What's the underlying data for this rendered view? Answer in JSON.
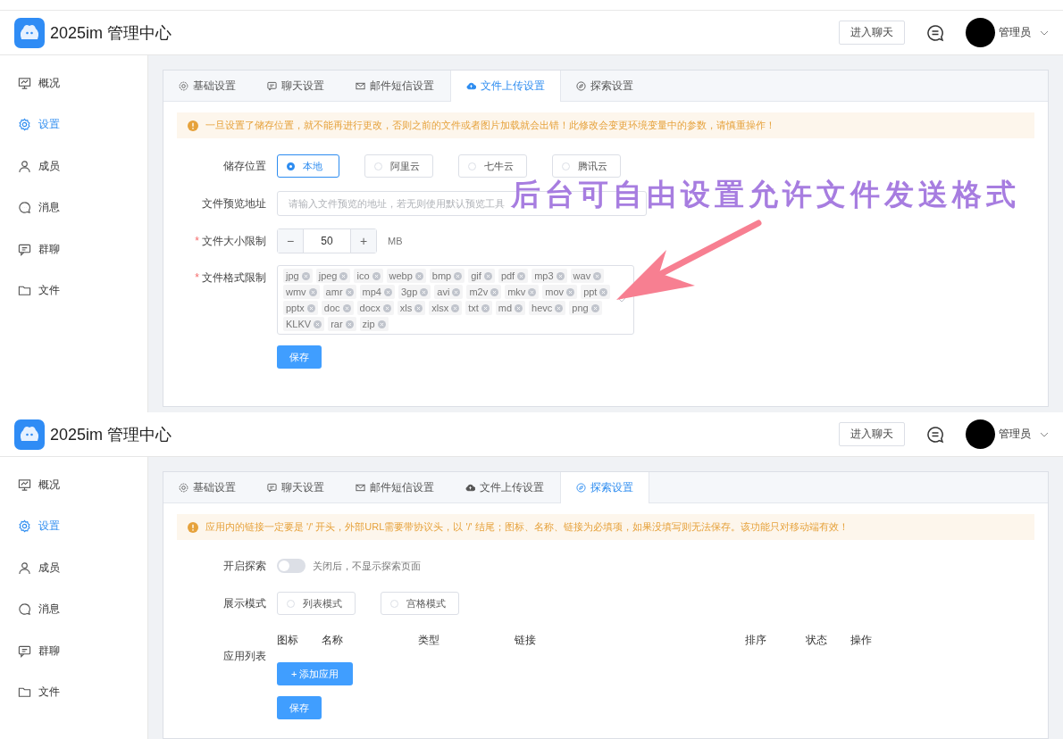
{
  "screens": [
    {
      "header": {
        "title": "2025im 管理中心",
        "chat_button": "进入聊天",
        "user": "管理员"
      },
      "sidebar": {
        "items": [
          {
            "label": "概况",
            "selected": false
          },
          {
            "label": "设置",
            "selected": true
          },
          {
            "label": "成员",
            "selected": false
          },
          {
            "label": "消息",
            "selected": false
          },
          {
            "label": "群聊",
            "selected": false
          },
          {
            "label": "文件",
            "selected": false
          }
        ]
      },
      "tabs": [
        {
          "label": "基础设置",
          "selected": false
        },
        {
          "label": "聊天设置",
          "selected": false
        },
        {
          "label": "邮件短信设置",
          "selected": false
        },
        {
          "label": "文件上传设置",
          "selected": true
        },
        {
          "label": "探索设置",
          "selected": false
        }
      ],
      "alert": "一旦设置了储存位置，就不能再进行更改，否则之前的文件或者图片加载就会出错！此修改会变更环境变量中的参数，请慎重操作！",
      "fields": [
        {
          "kind": "radio",
          "label": "储存位置",
          "options": [
            {
              "label": "本地",
              "selected": true
            },
            {
              "label": "阿里云",
              "selected": false
            },
            {
              "label": "七牛云",
              "selected": false
            },
            {
              "label": "腾讯云",
              "selected": false
            }
          ]
        },
        {
          "kind": "input",
          "label": "文件预览地址",
          "placeholder": "请输入文件预览的地址，若无则使用默认预览工具"
        },
        {
          "kind": "number",
          "label": "文件大小限制",
          "required_mark": "*",
          "value": "50",
          "unit": "MB",
          "minus": "−",
          "plus": "+"
        },
        {
          "kind": "tags",
          "label": "文件格式限制",
          "required_mark": "*",
          "tags": [
            "jpg",
            "jpeg",
            "ico",
            "webp",
            "bmp",
            "gif",
            "pdf",
            "mp3",
            "wav",
            "wmv",
            "amr",
            "mp4",
            "3gp",
            "avi",
            "m2v",
            "mkv",
            "mov",
            "ppt",
            "pptx",
            "doc",
            "docx",
            "xls",
            "xlsx",
            "txt",
            "md",
            "hevc",
            "png",
            "KLKV",
            "rar",
            "zip"
          ]
        }
      ],
      "save_button": "保存",
      "annotation": {
        "text": "后台可自由设置允许文件发送格式"
      }
    },
    {
      "header": {
        "title": "2025im 管理中心",
        "chat_button": "进入聊天",
        "user": "管理员"
      },
      "sidebar": {
        "items": [
          {
            "label": "概况",
            "selected": false
          },
          {
            "label": "设置",
            "selected": true
          },
          {
            "label": "成员",
            "selected": false
          },
          {
            "label": "消息",
            "selected": false
          },
          {
            "label": "群聊",
            "selected": false
          },
          {
            "label": "文件",
            "selected": false
          }
        ]
      },
      "tabs": [
        {
          "label": "基础设置",
          "selected": false
        },
        {
          "label": "聊天设置",
          "selected": false
        },
        {
          "label": "邮件短信设置",
          "selected": false
        },
        {
          "label": "文件上传设置",
          "selected": false
        },
        {
          "label": "探索设置",
          "selected": true
        }
      ],
      "alert": "应用内的链接一定要是 '/' 开头，外部URL需要带协议头，以 '/' 结尾；图标、名称、链接为必填项，如果没填写则无法保存。该功能只对移动端有效！",
      "fields": [
        {
          "kind": "switch",
          "label": "开启探索",
          "on": false,
          "hint": "关闭后，不显示探索页面"
        },
        {
          "kind": "radio",
          "label": "展示模式",
          "options": [
            {
              "label": "列表模式",
              "selected": false
            },
            {
              "label": "宫格模式",
              "selected": false
            }
          ]
        },
        {
          "kind": "table",
          "label": "应用列表",
          "columns": [
            "图标",
            "名称",
            "类型",
            "链接",
            "排序",
            "状态",
            "操作"
          ],
          "add_button": "添加应用",
          "add_icon": "+"
        }
      ],
      "save_button": "保存"
    }
  ]
}
